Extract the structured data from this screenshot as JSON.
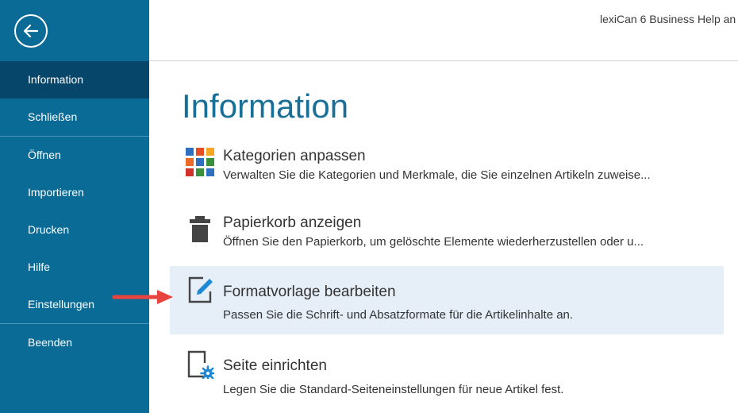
{
  "app_title": "lexiCan 6 Business Help an",
  "sidebar": {
    "back_icon": "back-arrow-icon",
    "items": [
      {
        "label": "Information",
        "active": true
      },
      {
        "label": "Schließen"
      },
      {
        "label": "Öffnen"
      },
      {
        "label": "Importieren"
      },
      {
        "label": "Drucken"
      },
      {
        "label": "Hilfe"
      },
      {
        "label": "Einstellungen"
      },
      {
        "label": "Beenden"
      }
    ]
  },
  "main": {
    "title": "Information",
    "options": [
      {
        "icon": "categories-grid-icon",
        "title": "Kategorien anpassen",
        "description": "Verwalten Sie die Kategorien und Merkmale, die Sie einzelnen Artikeln zuweise..."
      },
      {
        "icon": "trash-icon",
        "title": "Papierkorb anzeigen",
        "description": "Öffnen Sie den Papierkorb, um gelöschte Elemente wiederherzustellen oder u..."
      },
      {
        "icon": "edit-template-icon",
        "title": "Formatvorlage bearbeiten",
        "description": "Passen Sie die Schrift- und Absatzformate für die Artikelinhalte an.",
        "highlighted": true
      },
      {
        "icon": "page-setup-icon",
        "title": "Seite einrichten",
        "description": "Legen Sie die Standard-Seiteneinstellungen für neue Artikel fest."
      }
    ]
  },
  "colors": {
    "sidebar": "#0a6b96",
    "sidebar_active": "#05466a",
    "title_blue": "#1a6f96",
    "highlight": "#e6eef8",
    "annotation_arrow": "#e8433e"
  }
}
